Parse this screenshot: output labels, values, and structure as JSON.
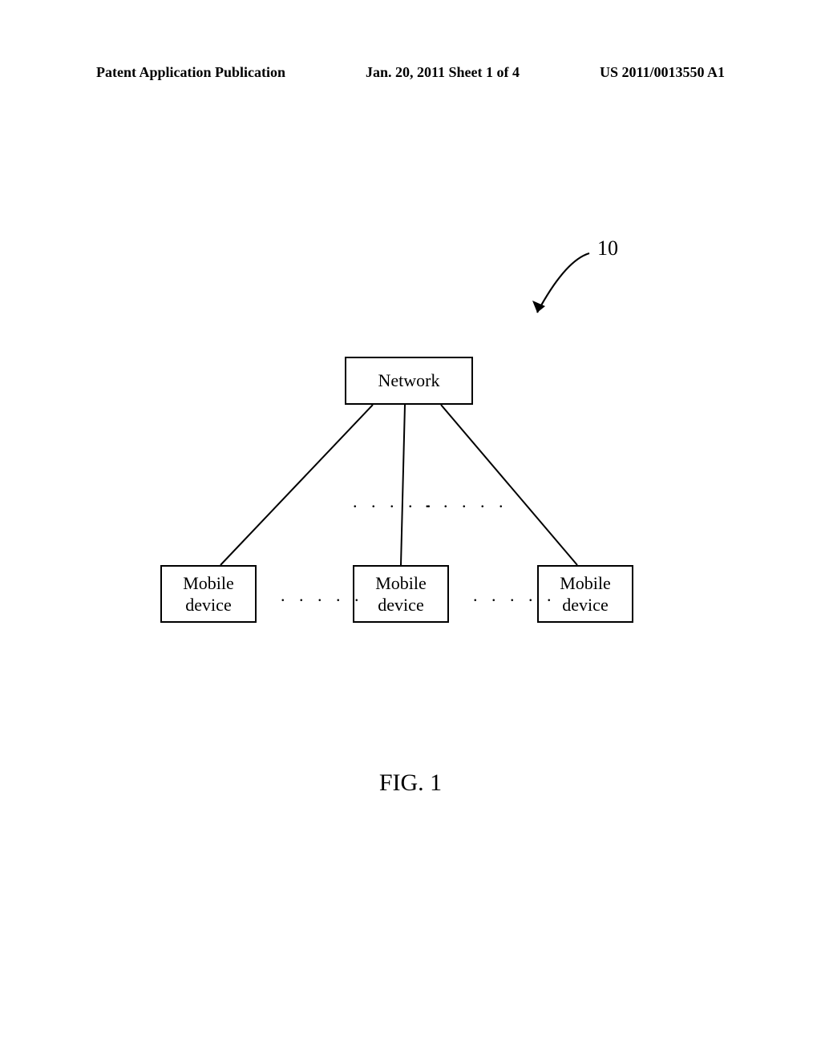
{
  "header": {
    "left": "Patent Application Publication",
    "center": "Jan. 20, 2011  Sheet 1 of 4",
    "right": "US 2011/0013550 A1"
  },
  "reference_number": "10",
  "diagram": {
    "network_label": "Network",
    "mobile_label_1": "Mobile\ndevice",
    "mobile_label_2": "Mobile\ndevice",
    "mobile_label_3": "Mobile\ndevice",
    "dots": ". . . . ."
  },
  "figure_label": "FIG. 1"
}
